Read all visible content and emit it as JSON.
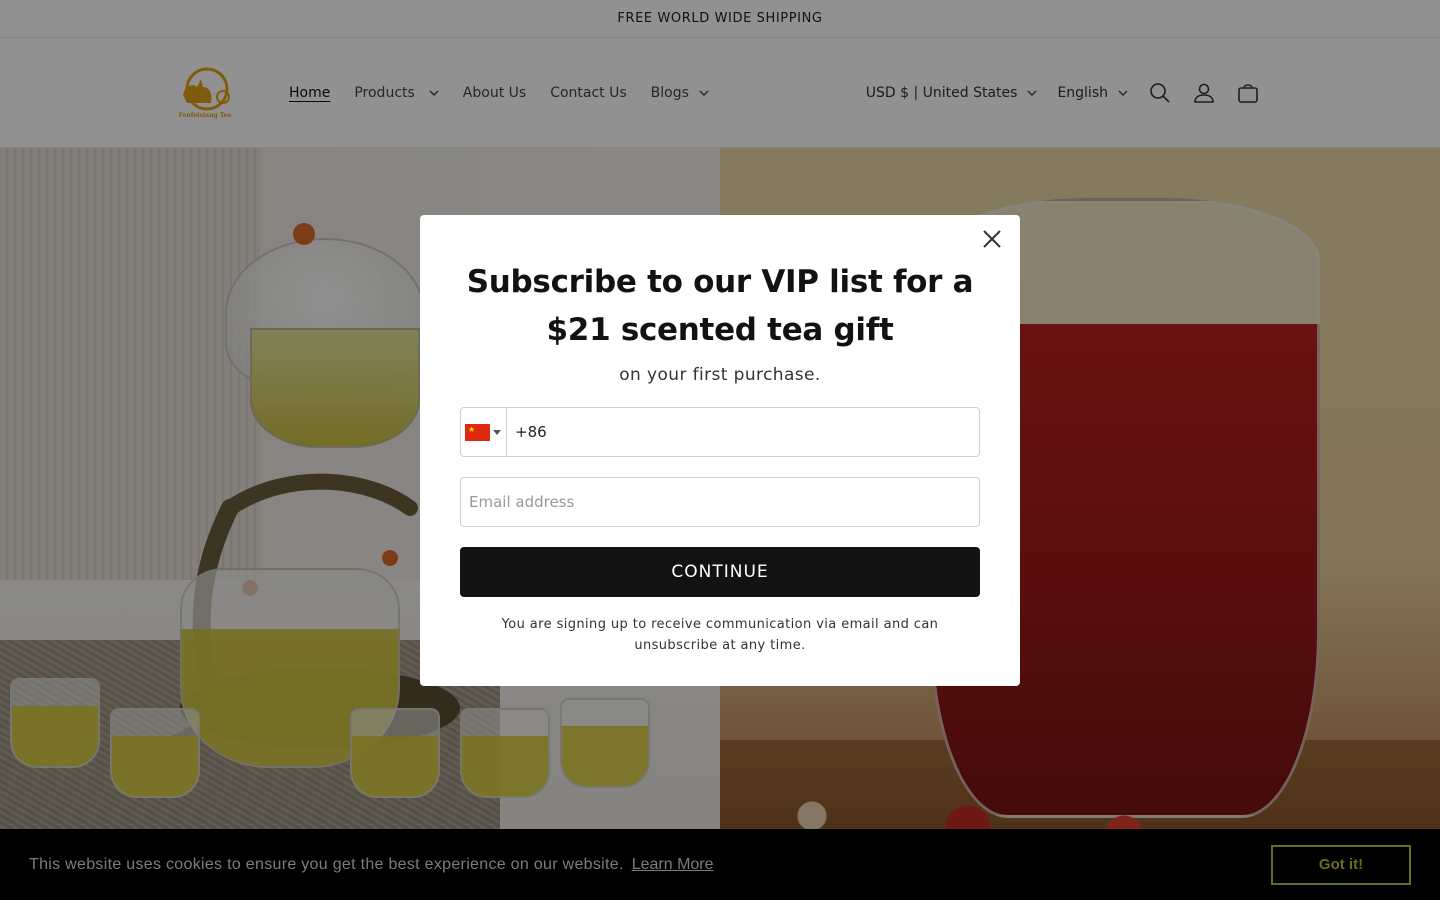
{
  "announcement": "FREE WORLD WIDE SHIPPING",
  "logo": {
    "text": "Fenfeixiang Tea",
    "color": "#e0a318"
  },
  "nav": {
    "items": [
      {
        "label": "Home",
        "active": true,
        "has_dropdown": false
      },
      {
        "label": "Products",
        "active": false,
        "has_dropdown": true
      },
      {
        "label": "About Us",
        "active": false,
        "has_dropdown": false
      },
      {
        "label": "Contact Us",
        "active": false,
        "has_dropdown": false
      },
      {
        "label": "Blogs",
        "active": false,
        "has_dropdown": true
      }
    ]
  },
  "header_tools": {
    "currency": "USD $ | United States",
    "language": "English",
    "icons": [
      "search-icon",
      "account-icon",
      "cart-icon"
    ]
  },
  "modal": {
    "title": "Subscribe to our VIP list for a $21 scented tea gift",
    "subtitle": "on your first purchase.",
    "phone_code": "+86",
    "phone_country": "China",
    "email_placeholder": "Email address",
    "continue_label": "CONTINUE",
    "disclaimer": "You are signing up to receive communication via email and can unsubscribe at any time."
  },
  "cookie_banner": {
    "message": "This website uses cookies to ensure you get the best experience on our website.",
    "link_label": "Learn More",
    "button_label": "Got it!",
    "button_color": "#6b6b1e"
  }
}
